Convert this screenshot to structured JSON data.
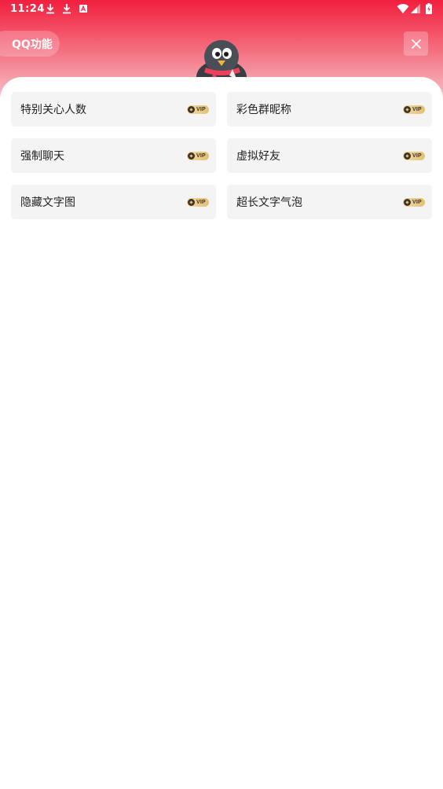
{
  "status_bar": {
    "time": "11:24",
    "icons": [
      "download-icon",
      "download-icon",
      "app-store-icon",
      "wifi-icon",
      "signal-icon",
      "battery-icon"
    ]
  },
  "header": {
    "title": "QQ功能",
    "close_icon": "close-icon",
    "mascot": "qq-penguin-mascot"
  },
  "features": [
    {
      "label": "特别关心人数",
      "badge": "VIP"
    },
    {
      "label": "彩色群昵称",
      "badge": "VIP"
    },
    {
      "label": "强制聊天",
      "badge": "VIP"
    },
    {
      "label": "虚拟好友",
      "badge": "VIP"
    },
    {
      "label": "隐藏文字图",
      "badge": "VIP"
    },
    {
      "label": "超长文字气泡",
      "badge": "VIP"
    }
  ],
  "colors": {
    "header_top": "#f21f3e",
    "card_bg": "#f4f4f4",
    "vip_gold": "#e3bf74"
  }
}
